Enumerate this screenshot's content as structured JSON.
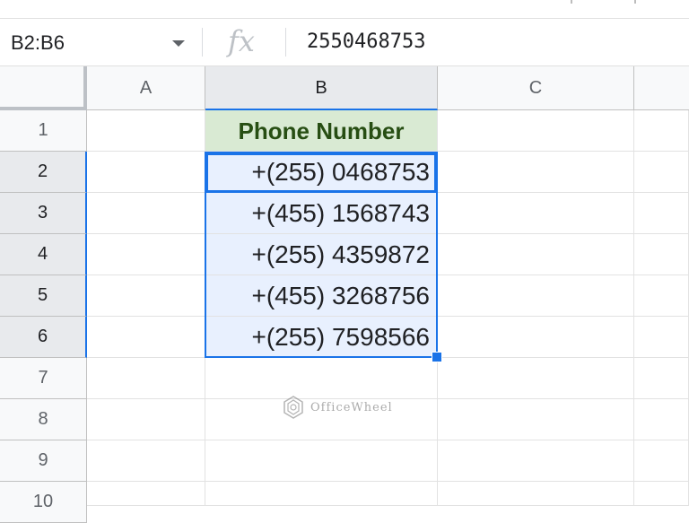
{
  "formula_bar": {
    "name_box": "B2:B6",
    "fx_label": "fx",
    "value": "2550468753"
  },
  "columns": [
    "A",
    "B",
    "C"
  ],
  "rows": [
    "1",
    "2",
    "3",
    "4",
    "5",
    "6",
    "7",
    "8",
    "9",
    "10"
  ],
  "sheet": {
    "header": "Phone Number",
    "phones": [
      "+(255) 0468753",
      "+(455) 1568743",
      "+(255) 4359872",
      "+(455) 3268756",
      "+(255) 7598566"
    ]
  },
  "watermark": {
    "text": "OfficeWheel",
    "icon": "officewheel-logo-icon"
  },
  "colors": {
    "selection": "#1a73e8",
    "header_fill": "#d9ead3",
    "header_text": "#274e13",
    "selected_fill": "#e8f0fe"
  }
}
